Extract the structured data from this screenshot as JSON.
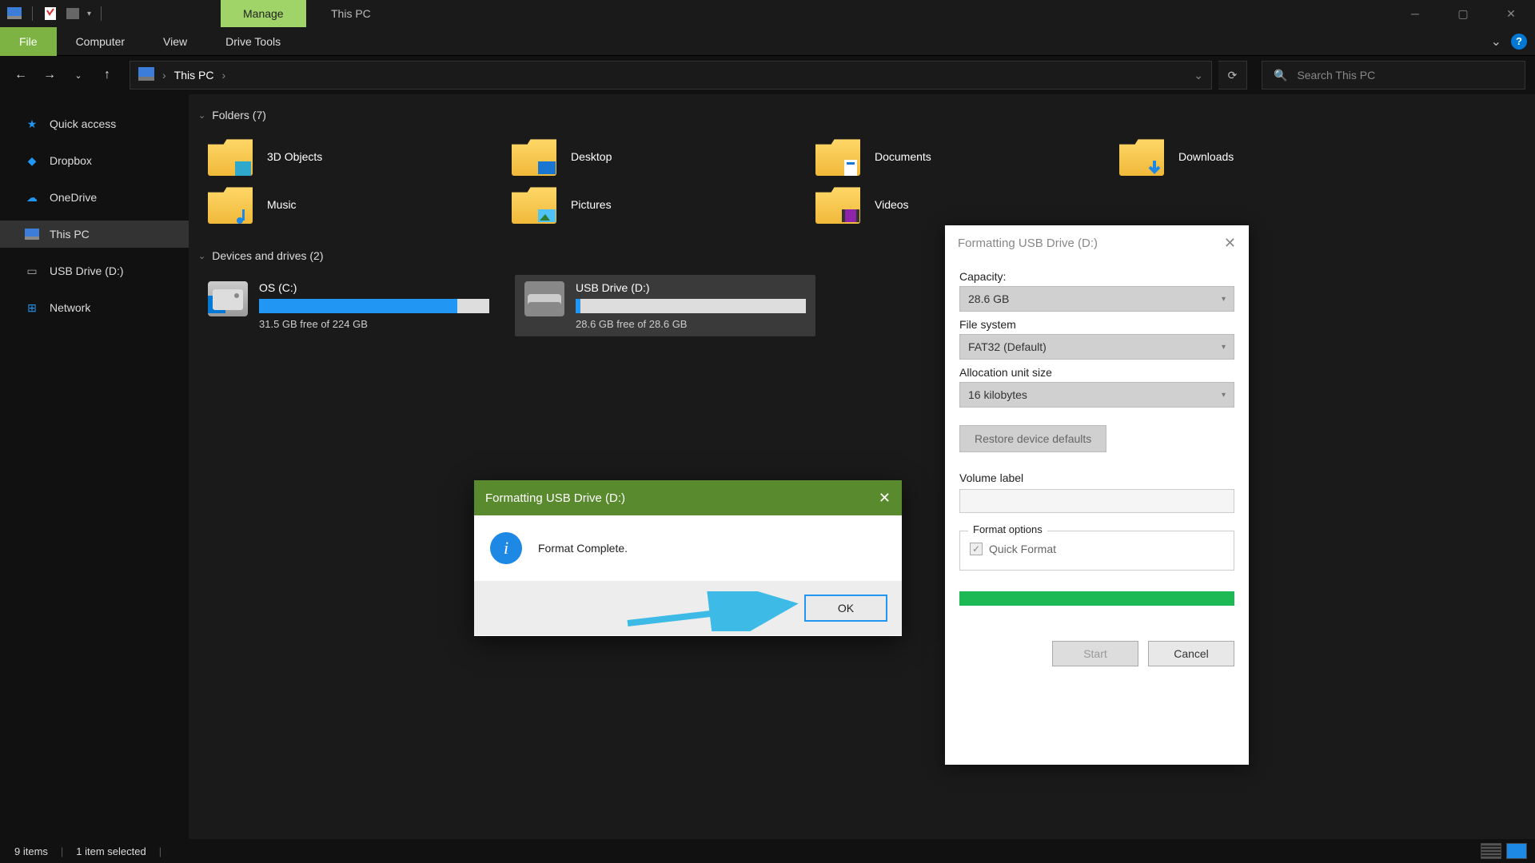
{
  "titlebar": {
    "manage_tab": "Manage",
    "title": "This PC"
  },
  "ribbon": {
    "file": "File",
    "tabs": [
      "Computer",
      "View",
      "Drive Tools"
    ]
  },
  "nav": {
    "location": "This PC",
    "search_placeholder": "Search This PC"
  },
  "sidebar": {
    "items": [
      {
        "label": "Quick access"
      },
      {
        "label": "Dropbox"
      },
      {
        "label": "OneDrive"
      },
      {
        "label": "This PC"
      },
      {
        "label": "USB Drive (D:)"
      },
      {
        "label": "Network"
      }
    ]
  },
  "groups": {
    "folders_header": "Folders (7)",
    "drives_header": "Devices and drives (2)"
  },
  "folders": [
    {
      "label": "3D Objects"
    },
    {
      "label": "Desktop"
    },
    {
      "label": "Documents"
    },
    {
      "label": "Downloads"
    },
    {
      "label": "Music"
    },
    {
      "label": "Pictures"
    },
    {
      "label": "Videos"
    }
  ],
  "drives": [
    {
      "label": "OS (C:)",
      "sub": "31.5 GB free of 224 GB",
      "fill": 86
    },
    {
      "label": "USB Drive (D:)",
      "sub": "28.6 GB free of 28.6 GB",
      "fill": 2
    }
  ],
  "status": {
    "items": "9 items",
    "selected": "1 item selected"
  },
  "format_dialog": {
    "title": "Formatting USB Drive (D:)",
    "capacity_label": "Capacity:",
    "capacity_value": "28.6 GB",
    "fs_label": "File system",
    "fs_value": "FAT32 (Default)",
    "alloc_label": "Allocation unit size",
    "alloc_value": "16 kilobytes",
    "restore": "Restore device defaults",
    "volume_label": "Volume label",
    "options_label": "Format options",
    "quick_format": "Quick Format",
    "start": "Start",
    "cancel": "Cancel"
  },
  "msgbox": {
    "title": "Formatting USB Drive (D:)",
    "message": "Format Complete.",
    "ok": "OK"
  }
}
